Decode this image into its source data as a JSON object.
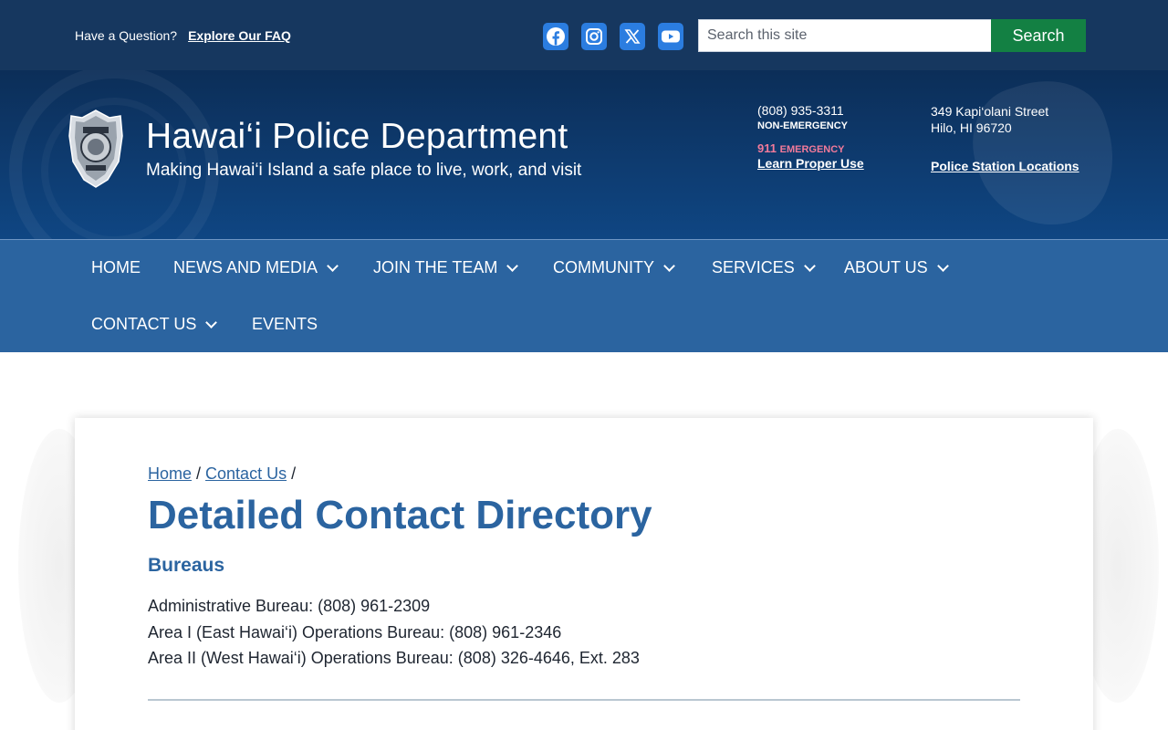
{
  "utility": {
    "question": "Have a Question?",
    "faq_link": "Explore Our FAQ",
    "socials": [
      "facebook-icon",
      "instagram-icon",
      "x-icon",
      "youtube-icon"
    ],
    "search_placeholder": "Search this site",
    "search_button": "Search"
  },
  "header": {
    "title": "Hawai‘i Police Department",
    "tagline": "Making Hawai‘i Island a safe place to live, work, and visit",
    "non_emergency_phone": "(808) 935-3311",
    "non_emergency_label": "NON-EMERGENCY",
    "emergency_number": "911",
    "emergency_label": "EMERGENCY",
    "learn_link": "Learn Proper Use",
    "address_line1": "349 Kapi‘olani Street",
    "address_line2": "Hilo, HI 96720",
    "locations_link": "Police Station Locations"
  },
  "nav": {
    "items": [
      {
        "label": "HOME"
      },
      {
        "label": "NEWS AND MEDIA"
      },
      {
        "label": "JOIN THE TEAM"
      },
      {
        "label": "COMMUNITY"
      },
      {
        "label": "SERVICES"
      },
      {
        "label": "ABOUT US"
      },
      {
        "label": "CONTACT US"
      },
      {
        "label": "EVENTS"
      }
    ]
  },
  "content": {
    "breadcrumb": {
      "home": "Home",
      "sep1": "/",
      "contact": "Contact Us",
      "sep2": "/"
    },
    "title": "Detailed Contact Directory",
    "section": "Bureaus",
    "bureaus": [
      "Administrative Bureau: (808) 961-2309",
      "Area I (East Hawai‘i) Operations Bureau: (808) 961-2346",
      "Area II (West Hawai‘i) Operations Bureau: (808) 326-4646, Ext. 283"
    ]
  },
  "colors": {
    "utility_bg": "#16375f",
    "nav_bg": "#2b64a0",
    "accent": "#2b64a0",
    "search_button": "#138043",
    "social_icon": "#2b7de0",
    "emergency": "#f27a9a"
  }
}
